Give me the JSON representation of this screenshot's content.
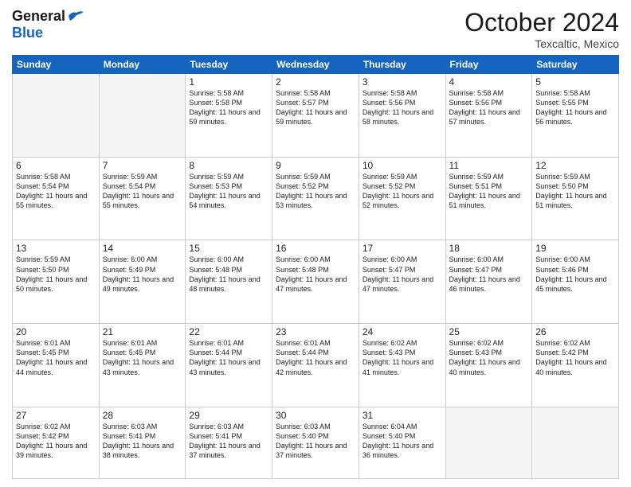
{
  "header": {
    "logo_line1": "General",
    "logo_line2": "Blue",
    "month": "October 2024",
    "location": "Texcaltic, Mexico"
  },
  "weekdays": [
    "Sunday",
    "Monday",
    "Tuesday",
    "Wednesday",
    "Thursday",
    "Friday",
    "Saturday"
  ],
  "weeks": [
    [
      {
        "day": "",
        "info": ""
      },
      {
        "day": "",
        "info": ""
      },
      {
        "day": "1",
        "info": "Sunrise: 5:58 AM\nSunset: 5:58 PM\nDaylight: 11 hours and 59 minutes."
      },
      {
        "day": "2",
        "info": "Sunrise: 5:58 AM\nSunset: 5:57 PM\nDaylight: 11 hours and 59 minutes."
      },
      {
        "day": "3",
        "info": "Sunrise: 5:58 AM\nSunset: 5:56 PM\nDaylight: 11 hours and 58 minutes."
      },
      {
        "day": "4",
        "info": "Sunrise: 5:58 AM\nSunset: 5:56 PM\nDaylight: 11 hours and 57 minutes."
      },
      {
        "day": "5",
        "info": "Sunrise: 5:58 AM\nSunset: 5:55 PM\nDaylight: 11 hours and 56 minutes."
      }
    ],
    [
      {
        "day": "6",
        "info": "Sunrise: 5:58 AM\nSunset: 5:54 PM\nDaylight: 11 hours and 55 minutes."
      },
      {
        "day": "7",
        "info": "Sunrise: 5:59 AM\nSunset: 5:54 PM\nDaylight: 11 hours and 55 minutes."
      },
      {
        "day": "8",
        "info": "Sunrise: 5:59 AM\nSunset: 5:53 PM\nDaylight: 11 hours and 54 minutes."
      },
      {
        "day": "9",
        "info": "Sunrise: 5:59 AM\nSunset: 5:52 PM\nDaylight: 11 hours and 53 minutes."
      },
      {
        "day": "10",
        "info": "Sunrise: 5:59 AM\nSunset: 5:52 PM\nDaylight: 11 hours and 52 minutes."
      },
      {
        "day": "11",
        "info": "Sunrise: 5:59 AM\nSunset: 5:51 PM\nDaylight: 11 hours and 51 minutes."
      },
      {
        "day": "12",
        "info": "Sunrise: 5:59 AM\nSunset: 5:50 PM\nDaylight: 11 hours and 51 minutes."
      }
    ],
    [
      {
        "day": "13",
        "info": "Sunrise: 5:59 AM\nSunset: 5:50 PM\nDaylight: 11 hours and 50 minutes."
      },
      {
        "day": "14",
        "info": "Sunrise: 6:00 AM\nSunset: 5:49 PM\nDaylight: 11 hours and 49 minutes."
      },
      {
        "day": "15",
        "info": "Sunrise: 6:00 AM\nSunset: 5:48 PM\nDaylight: 11 hours and 48 minutes."
      },
      {
        "day": "16",
        "info": "Sunrise: 6:00 AM\nSunset: 5:48 PM\nDaylight: 11 hours and 47 minutes."
      },
      {
        "day": "17",
        "info": "Sunrise: 6:00 AM\nSunset: 5:47 PM\nDaylight: 11 hours and 47 minutes."
      },
      {
        "day": "18",
        "info": "Sunrise: 6:00 AM\nSunset: 5:47 PM\nDaylight: 11 hours and 46 minutes."
      },
      {
        "day": "19",
        "info": "Sunrise: 6:00 AM\nSunset: 5:46 PM\nDaylight: 11 hours and 45 minutes."
      }
    ],
    [
      {
        "day": "20",
        "info": "Sunrise: 6:01 AM\nSunset: 5:45 PM\nDaylight: 11 hours and 44 minutes."
      },
      {
        "day": "21",
        "info": "Sunrise: 6:01 AM\nSunset: 5:45 PM\nDaylight: 11 hours and 43 minutes."
      },
      {
        "day": "22",
        "info": "Sunrise: 6:01 AM\nSunset: 5:44 PM\nDaylight: 11 hours and 43 minutes."
      },
      {
        "day": "23",
        "info": "Sunrise: 6:01 AM\nSunset: 5:44 PM\nDaylight: 11 hours and 42 minutes."
      },
      {
        "day": "24",
        "info": "Sunrise: 6:02 AM\nSunset: 5:43 PM\nDaylight: 11 hours and 41 minutes."
      },
      {
        "day": "25",
        "info": "Sunrise: 6:02 AM\nSunset: 5:43 PM\nDaylight: 11 hours and 40 minutes."
      },
      {
        "day": "26",
        "info": "Sunrise: 6:02 AM\nSunset: 5:42 PM\nDaylight: 11 hours and 40 minutes."
      }
    ],
    [
      {
        "day": "27",
        "info": "Sunrise: 6:02 AM\nSunset: 5:42 PM\nDaylight: 11 hours and 39 minutes."
      },
      {
        "day": "28",
        "info": "Sunrise: 6:03 AM\nSunset: 5:41 PM\nDaylight: 11 hours and 38 minutes."
      },
      {
        "day": "29",
        "info": "Sunrise: 6:03 AM\nSunset: 5:41 PM\nDaylight: 11 hours and 37 minutes."
      },
      {
        "day": "30",
        "info": "Sunrise: 6:03 AM\nSunset: 5:40 PM\nDaylight: 11 hours and 37 minutes."
      },
      {
        "day": "31",
        "info": "Sunrise: 6:04 AM\nSunset: 5:40 PM\nDaylight: 11 hours and 36 minutes."
      },
      {
        "day": "",
        "info": ""
      },
      {
        "day": "",
        "info": ""
      }
    ]
  ]
}
